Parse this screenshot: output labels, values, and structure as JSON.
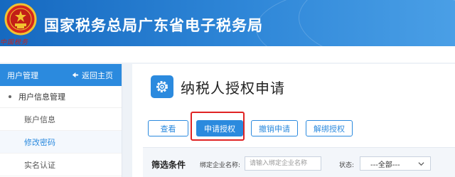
{
  "header": {
    "site_title": "国家税务总局广东省电子税务局",
    "emblem_script": "中国税务"
  },
  "sidebar": {
    "title": "用户管理",
    "back_label": "返回主页",
    "group_label": "用户信息管理",
    "items": [
      {
        "label": "账户信息",
        "active": false
      },
      {
        "label": "修改密码",
        "active": true
      },
      {
        "label": "实名认证",
        "active": false
      }
    ]
  },
  "main": {
    "page_title": "纳税人授权申请",
    "buttons": {
      "view": "查看",
      "apply": "申请授权",
      "revoke": "撤销申请",
      "unbind": "解绑授权"
    },
    "filter": {
      "title": "筛选条件",
      "company_label": "绑定企业名称:",
      "company_placeholder": "请输入绑定企业名称",
      "status_label": "状态:",
      "status_value": "---全部---"
    }
  },
  "colors": {
    "brand_blue": "#2b8ade",
    "highlight_red": "#e02323",
    "header_blue": "#1a73c9"
  },
  "icons": {
    "emblem": "national-emblem-icon",
    "back": "home-return-icon",
    "title": "gear-icon",
    "select": "chevron-down-icon"
  }
}
